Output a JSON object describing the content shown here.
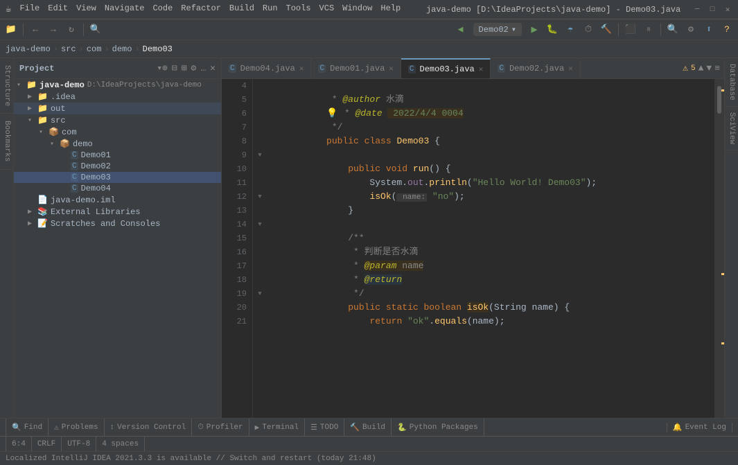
{
  "titlebar": {
    "app_icon": "☕",
    "menus": [
      "File",
      "Edit",
      "View",
      "Navigate",
      "Code",
      "Refactor",
      "Build",
      "Run",
      "Tools",
      "VCS",
      "Window",
      "Help"
    ],
    "title": "java-demo [D:\\IdeaProjects\\java-demo] - Demo03.java",
    "window_controls": [
      "─",
      "□",
      "✕"
    ]
  },
  "breadcrumb": {
    "items": [
      "java-demo",
      "src",
      "com",
      "demo",
      "Demo03"
    ]
  },
  "toolbar": {
    "run_config": "Demo02",
    "buttons": [
      "search",
      "back",
      "forward",
      "bookmark",
      "run",
      "debug",
      "coverage",
      "profile",
      "build"
    ]
  },
  "sidebar": {
    "title": "Project",
    "root": {
      "name": "java-demo",
      "path": "D:\\IdeaProjects\\java-demo",
      "children": [
        {
          "name": ".idea",
          "type": "folder",
          "expanded": false
        },
        {
          "name": "out",
          "type": "folder",
          "expanded": false
        },
        {
          "name": "src",
          "type": "folder",
          "expanded": true,
          "children": [
            {
              "name": "com",
              "type": "folder",
              "expanded": true,
              "children": [
                {
                  "name": "demo",
                  "type": "folder",
                  "expanded": true,
                  "children": [
                    {
                      "name": "Demo01",
                      "type": "class"
                    },
                    {
                      "name": "Demo02",
                      "type": "class"
                    },
                    {
                      "name": "Demo03",
                      "type": "class",
                      "selected": true
                    },
                    {
                      "name": "Demo04",
                      "type": "class"
                    }
                  ]
                }
              ]
            }
          ]
        },
        {
          "name": "java-demo.iml",
          "type": "file"
        },
        {
          "name": "External Libraries",
          "type": "library",
          "expanded": false
        },
        {
          "name": "Scratches and Consoles",
          "type": "scratches",
          "expanded": false
        }
      ]
    }
  },
  "tabs": [
    {
      "label": "Demo04.java",
      "active": false,
      "icon": "C"
    },
    {
      "label": "Demo01.java",
      "active": false,
      "icon": "C"
    },
    {
      "label": "Demo03.java",
      "active": true,
      "icon": "C"
    },
    {
      "label": "Demo02.java",
      "active": false,
      "icon": "C"
    }
  ],
  "editor": {
    "lines": [
      {
        "num": 4,
        "content": " * @author 水滴",
        "type": "comment-author"
      },
      {
        "num": 5,
        "content": " * @date 2022/4/4 0004",
        "type": "comment-date",
        "bulb": true
      },
      {
        "num": 6,
        "content": " */",
        "type": "comment"
      },
      {
        "num": 7,
        "content": "public class Demo03 {",
        "type": "class-decl"
      },
      {
        "num": 8,
        "content": "",
        "type": "empty"
      },
      {
        "num": 9,
        "content": "    public void run() {",
        "type": "method-decl",
        "foldable": true
      },
      {
        "num": 10,
        "content": "        System.out.println(\"Hello World! Demo03\");",
        "type": "code"
      },
      {
        "num": 11,
        "content": "        isOk( name: \"no\");",
        "type": "code-hint"
      },
      {
        "num": 12,
        "content": "    }",
        "type": "code",
        "foldable": true
      },
      {
        "num": 13,
        "content": "",
        "type": "empty"
      },
      {
        "num": 14,
        "content": "    /**",
        "type": "comment",
        "foldable": true
      },
      {
        "num": 15,
        "content": "     * 判断是否水滴",
        "type": "comment"
      },
      {
        "num": 16,
        "content": "     * @param name",
        "type": "comment-param"
      },
      {
        "num": 17,
        "content": "     * @return",
        "type": "comment-return"
      },
      {
        "num": 18,
        "content": "     */",
        "type": "comment"
      },
      {
        "num": 19,
        "content": "    public static boolean isOk(String name) {",
        "type": "method-decl",
        "foldable": true
      },
      {
        "num": 20,
        "content": "        return \"ok\".equals(name);",
        "type": "code"
      },
      {
        "num": 21,
        "content": "",
        "type": "empty"
      }
    ]
  },
  "status_bar": {
    "bottom_tabs": [
      {
        "icon": "🔍",
        "label": "Find"
      },
      {
        "icon": "⚠",
        "label": "Problems"
      },
      {
        "icon": "↕",
        "label": "Version Control"
      },
      {
        "icon": "⏱",
        "label": "Profiler"
      },
      {
        "icon": "▶",
        "label": "Terminal"
      },
      {
        "icon": "☰",
        "label": "TODO"
      },
      {
        "icon": "🔨",
        "label": "Build"
      },
      {
        "icon": "🐍",
        "label": "Python Packages"
      }
    ],
    "right": {
      "event_log": "Event Log",
      "position": "6:4",
      "line_ending": "CRLF",
      "encoding": "UTF-8",
      "indent": "4 spaces"
    }
  },
  "notification": {
    "text": "Localized IntelliJ IDEA 2021.3.3 is available // Switch and restart (today 21:48)"
  },
  "warnings": {
    "count": "5",
    "icon": "⚠"
  },
  "right_panels": [
    "Database",
    "SciView"
  ]
}
